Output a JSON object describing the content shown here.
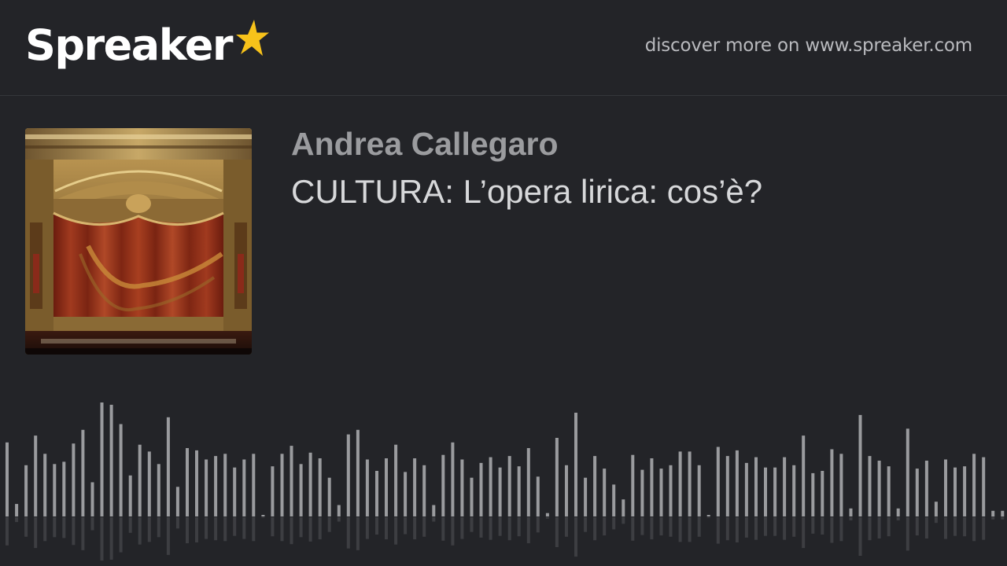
{
  "brand": {
    "name": "Spreaker",
    "star_color": "#f7c21a"
  },
  "header": {
    "discover_text": "discover more on www.spreaker.com"
  },
  "episode": {
    "author": "Andrea Callegaro",
    "title": "CULTURA: L’opera lirica: cos’è?",
    "cover_icon": "opera-house-stage-image"
  },
  "waveform": {
    "bar_color": "#9a9b9e",
    "levels": [
      0.65,
      0.11,
      0.45,
      0.71,
      0.55,
      0.46,
      0.48,
      0.64,
      0.76,
      0.3,
      1.0,
      0.98,
      0.81,
      0.36,
      0.63,
      0.57,
      0.46,
      0.87,
      0.26,
      0.6,
      0.58,
      0.5,
      0.53,
      0.55,
      0.43,
      0.5,
      0.55,
      0.0,
      0.44,
      0.55,
      0.62,
      0.46,
      0.56,
      0.51,
      0.34,
      0.1,
      0.72,
      0.76,
      0.5,
      0.4,
      0.51,
      0.63,
      0.39,
      0.51,
      0.45,
      0.1,
      0.54,
      0.65,
      0.5,
      0.34,
      0.47,
      0.52,
      0.43,
      0.53,
      0.44,
      0.6,
      0.35,
      0.03,
      0.69,
      0.45,
      0.91,
      0.34,
      0.53,
      0.42,
      0.28,
      0.15,
      0.54,
      0.41,
      0.51,
      0.42,
      0.45,
      0.57,
      0.57,
      0.45,
      0.0,
      0.61,
      0.53,
      0.58,
      0.47,
      0.52,
      0.43,
      0.43,
      0.52,
      0.45,
      0.71,
      0.38,
      0.4,
      0.59,
      0.55,
      0.07,
      0.89,
      0.53,
      0.49,
      0.44,
      0.07,
      0.77,
      0.42,
      0.49,
      0.13,
      0.5,
      0.43,
      0.44,
      0.55,
      0.52,
      0.05,
      0.05
    ]
  }
}
